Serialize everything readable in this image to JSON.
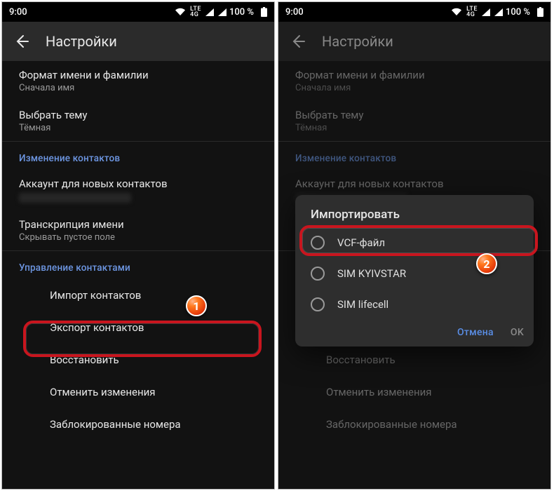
{
  "statusbar": {
    "time": "9:00",
    "lte_top": "LTE",
    "lte_bot": "4G",
    "battery_pct": "100 %"
  },
  "appbar": {
    "title": "Настройки"
  },
  "items": {
    "name_format_title": "Формат имени и фамилии",
    "name_format_sub": "Сначала имя",
    "theme_title": "Выбрать тему",
    "theme_sub": "Тёмная",
    "account_title": "Аккаунт для новых контактов",
    "transcription_title": "Транскрипция имени",
    "transcription_sub": "Скрывать пустое поле",
    "import_title": "Импорт контактов",
    "export_title": "Экспорт контактов",
    "restore_title": "Восстановить",
    "undo_title": "Отменить изменения",
    "blocked_title": "Заблокированные номера"
  },
  "sections": {
    "edit": "Изменение контактов",
    "manage": "Управление контактами"
  },
  "dialog": {
    "title": "Импортировать",
    "opt1": "VCF-файл",
    "opt2": "SIM KYIVSTAR",
    "opt3": "SIM lifecell",
    "cancel": "Отмена",
    "ok": "OK"
  },
  "badges": {
    "one": "1",
    "two": "2"
  },
  "colors": {
    "highlight": "#c9151e",
    "accent": "#6d96e2"
  }
}
